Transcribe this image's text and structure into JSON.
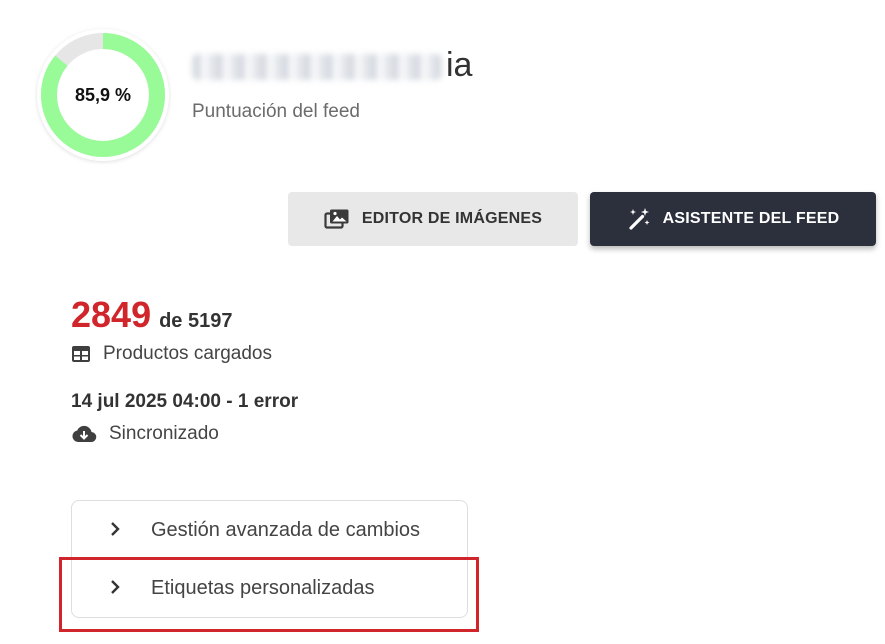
{
  "score": {
    "value_text": "85,9 %",
    "fraction": 0.859,
    "ring_color": "#98fb98",
    "track_color": "#e6e6e6"
  },
  "feed": {
    "name_visible_suffix": "ia",
    "subtitle": "Puntuación del feed"
  },
  "toolbar": {
    "image_editor_label": "EDITOR DE IMÁGENES",
    "image_editor_icon": "images-icon",
    "assistant_label": "ASISTENTE DEL FEED",
    "assistant_icon": "magic-wand-icon"
  },
  "products": {
    "loaded": "2849",
    "total_text": "de 5197",
    "label": "Productos cargados",
    "icon": "table-icon",
    "count_color": "#d0262b"
  },
  "sync": {
    "datetime": "14 jul 2025 04:00 - 1 error",
    "status": "Sincronizado",
    "icon": "cloud-download-icon"
  },
  "accordion": {
    "items": [
      {
        "label": "Gestión avanzada de cambios"
      },
      {
        "label": "Etiquetas personalizadas"
      }
    ]
  },
  "highlight_color": "#d0262b"
}
